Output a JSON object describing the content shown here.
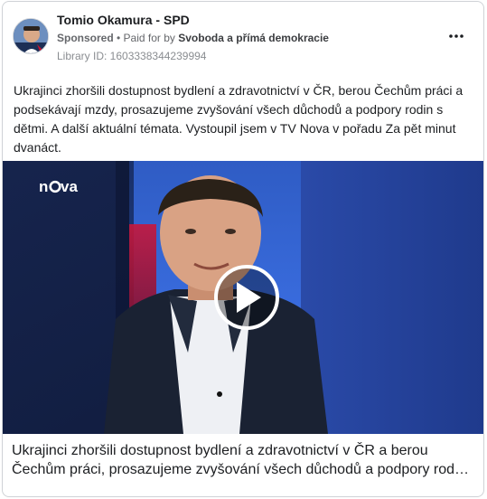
{
  "post": {
    "page_name": "Tomio Okamura - SPD",
    "sponsored_label": "Sponsored",
    "separator": " • ",
    "paid_for_prefix": "Paid for by ",
    "payer": "Svoboda a přímá demokracie",
    "library_id": "Library ID: 1603338344239994",
    "more_icon": "more-icon",
    "body_text": "Ukrajinci zhoršili dostupnost bydlení a zdravotnictví v ČR, berou Čechům práci a podsekávají mzdy, prosazujeme zvyšování všech důchodů a podpory rodin s dětmi. A další aktuální témata. Vystoupil jsem v TV Nova v pořadu Za pět minut dvanáct.",
    "video": {
      "channel_logo": "nova",
      "play_icon": "play-icon"
    },
    "caption": "Ukrajinci zhoršili dostupnost bydlení a zdravotnictví v ČR a berou Čechům práci, prosazujeme zvyšování všech důchodů a podpory rod…"
  }
}
